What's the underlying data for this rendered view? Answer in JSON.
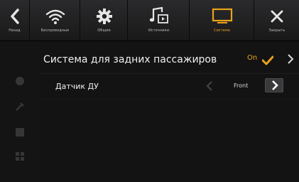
{
  "topbar": {
    "tabs": [
      {
        "label": "Назад",
        "icon": "back-icon"
      },
      {
        "label": "Беспроводные",
        "icon": "wifi-icon"
      },
      {
        "label": "Общие",
        "icon": "gear-icon"
      },
      {
        "label": "Источники",
        "icon": "music-source-icon"
      },
      {
        "label": "Система",
        "icon": "monitor-icon",
        "active": true
      },
      {
        "label": "Закрыть",
        "icon": "close-icon"
      }
    ]
  },
  "settings": {
    "rear_system": {
      "label": "Система для задних пассажиров",
      "value": "On"
    },
    "remote_sensor": {
      "label": "Датчик ДУ",
      "value": "Front"
    }
  },
  "colors": {
    "accent": "#e8a21c",
    "background": "#131314"
  }
}
